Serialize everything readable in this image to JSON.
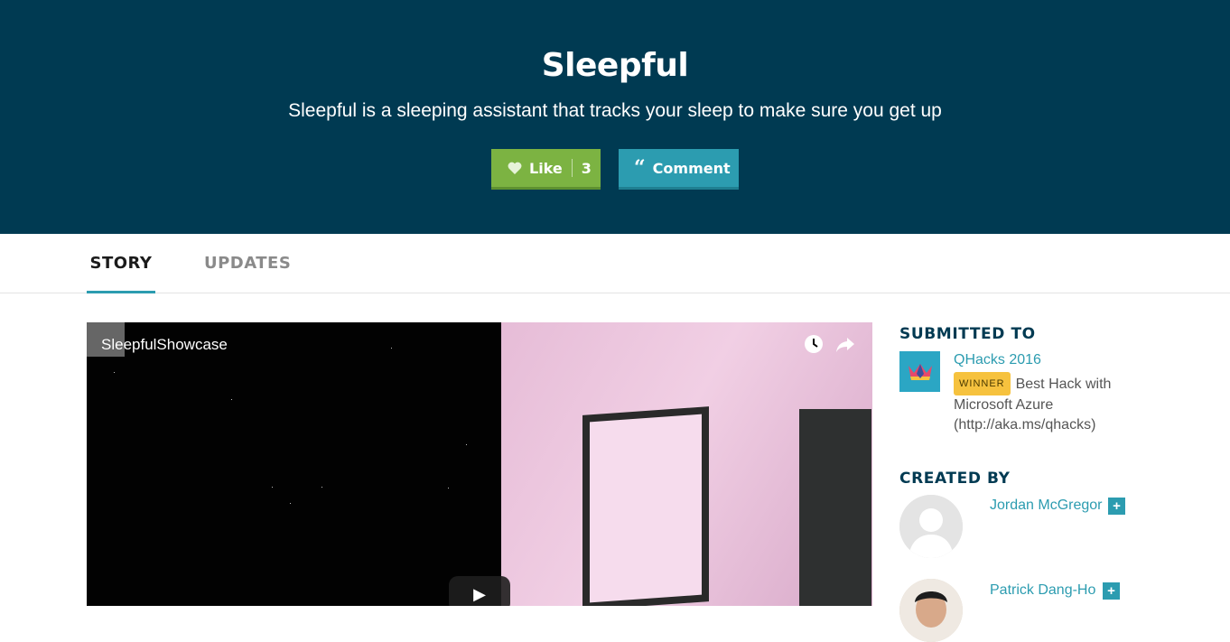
{
  "header": {
    "title": "Sleepful",
    "tagline": "Sleepful is a sleeping assistant that tracks your sleep to make sure you get up",
    "like_label": "Like",
    "like_count": "3",
    "comment_label": "Comment"
  },
  "tabs": [
    {
      "label": "STORY",
      "active": true
    },
    {
      "label": "UPDATES",
      "active": false
    }
  ],
  "video": {
    "title": "SleepfulShowcase",
    "icons": [
      "clock-icon",
      "share-icon",
      "play-icon"
    ]
  },
  "sidebar": {
    "submitted_heading": "SUBMITTED TO",
    "hackathon_name": "QHacks 2016",
    "winner_badge": "WINNER",
    "prize": "Best Hack with Microsoft Azure (http://aka.ms/qhacks)",
    "created_heading": "CREATED BY",
    "creators": [
      {
        "name": "Jordan McGregor"
      },
      {
        "name": "Patrick Dang-Ho"
      }
    ]
  },
  "colors": {
    "header_bg": "#003a52",
    "like": "#7cb342",
    "accent": "#2c9cb0",
    "winner": "#f6c23e"
  }
}
